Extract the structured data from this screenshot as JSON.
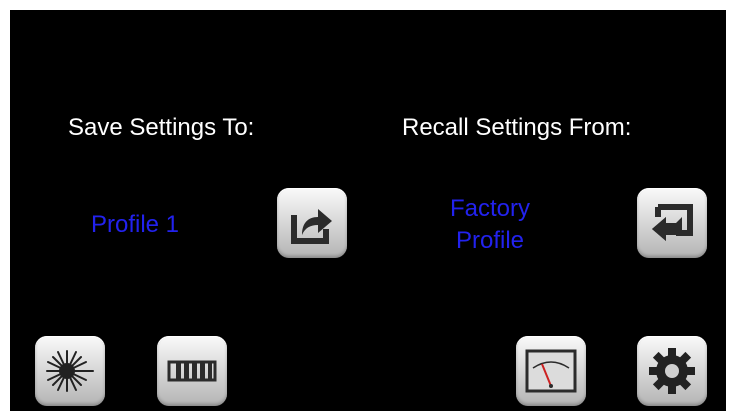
{
  "save": {
    "heading": "Save Settings To:",
    "profile_value": "Profile 1",
    "button_icon": "export-arrow-icon"
  },
  "recall": {
    "heading": "Recall Settings From:",
    "profile_value_line1": "Factory",
    "profile_value_line2": "Profile",
    "button_icon": "import-arrow-icon"
  },
  "nav": {
    "items": [
      {
        "icon": "laser-icon"
      },
      {
        "icon": "ruler-icon"
      },
      {
        "icon": "meter-gauge-icon"
      },
      {
        "icon": "gear-icon"
      }
    ]
  },
  "colors": {
    "background": "#000000",
    "heading_text": "#ffffff",
    "value_text": "#2222ee"
  }
}
